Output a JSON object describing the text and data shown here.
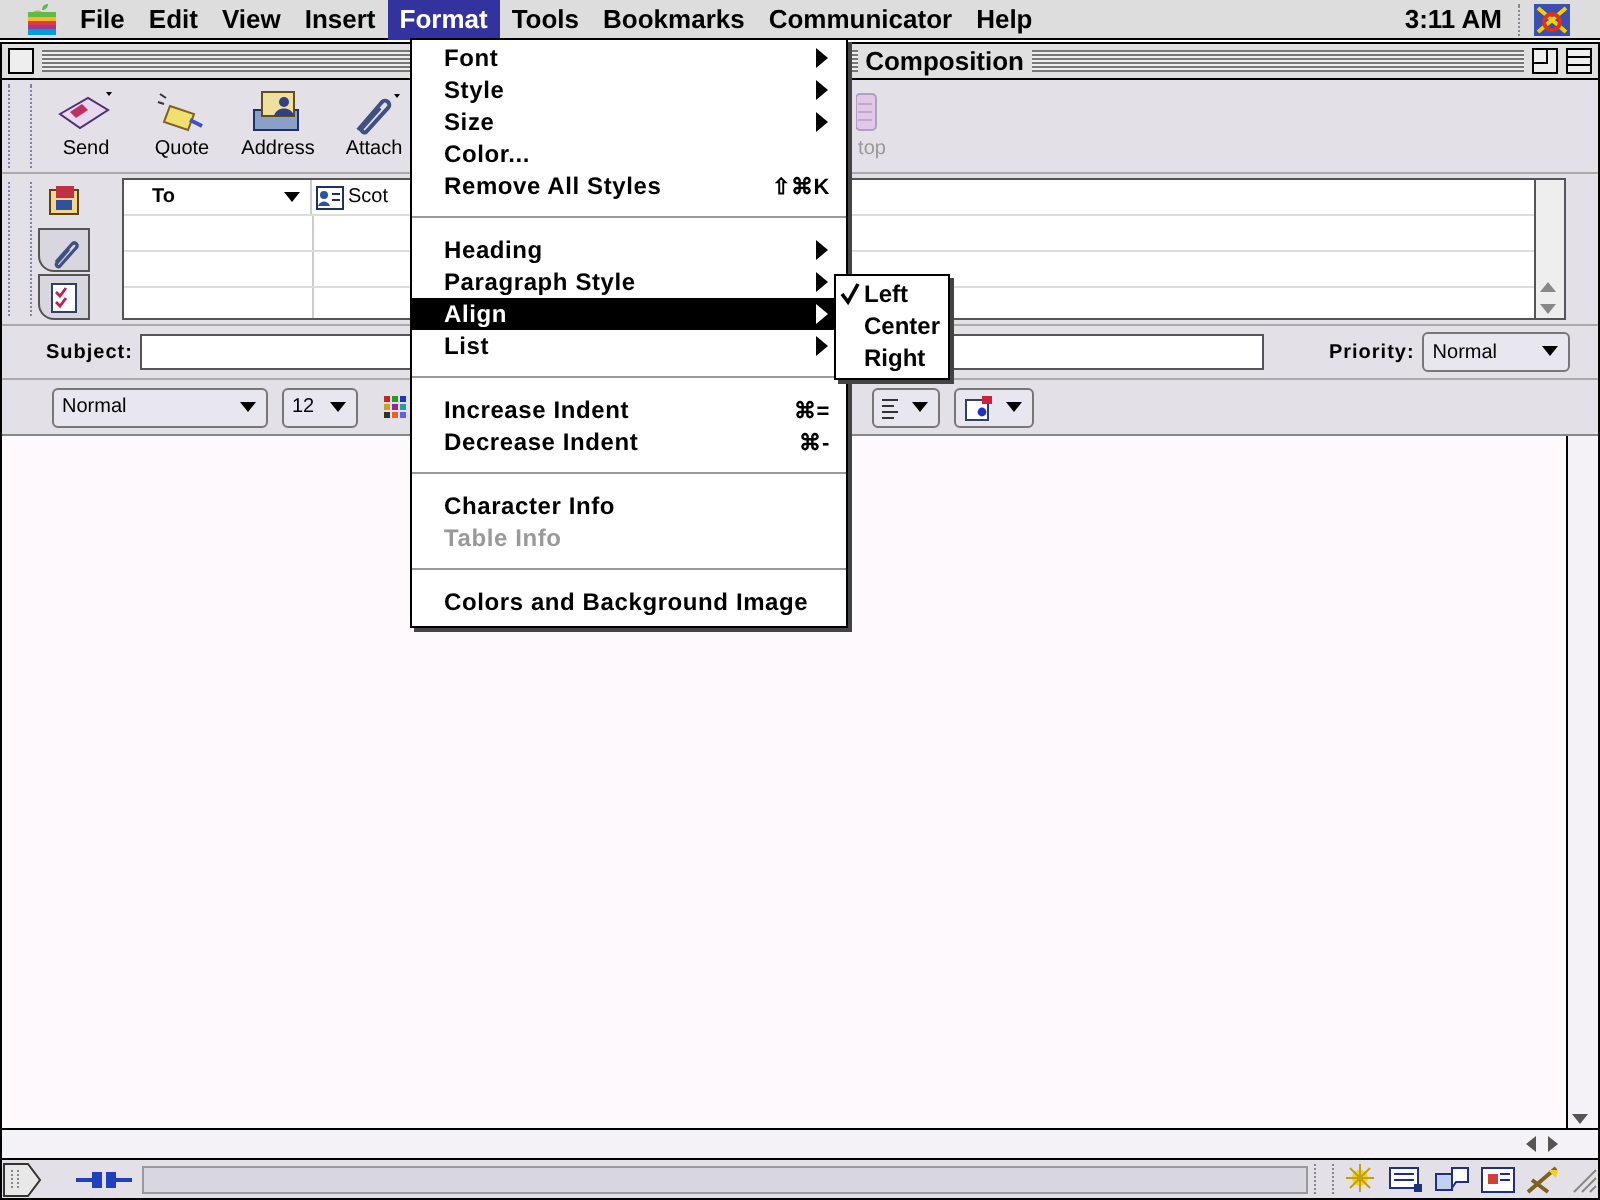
{
  "menubar": {
    "items": [
      {
        "label": "File",
        "selected": false
      },
      {
        "label": "Edit",
        "selected": false
      },
      {
        "label": "View",
        "selected": false
      },
      {
        "label": "Insert",
        "selected": false
      },
      {
        "label": "Format",
        "selected": true
      },
      {
        "label": "Tools",
        "selected": false
      },
      {
        "label": "Bookmarks",
        "selected": false
      },
      {
        "label": "Communicator",
        "selected": false
      },
      {
        "label": "Help",
        "selected": false
      }
    ],
    "clock": "3:11 AM"
  },
  "window": {
    "title": "Composition"
  },
  "toolbar": {
    "buttons": [
      {
        "label": "Send",
        "kind": "send",
        "disabled": false
      },
      {
        "label": "Quote",
        "kind": "quote",
        "disabled": false
      },
      {
        "label": "Address",
        "kind": "address",
        "disabled": false
      },
      {
        "label": "Attach",
        "kind": "attach",
        "disabled": false
      },
      {
        "label": "top",
        "kind": "stop",
        "disabled": true
      }
    ]
  },
  "addressing": {
    "tabs": [
      {
        "kind": "contacts",
        "selected": true
      },
      {
        "kind": "attachments",
        "selected": false
      },
      {
        "kind": "options",
        "selected": false
      }
    ],
    "rows": [
      {
        "type": "To",
        "recipient": "Scot"
      }
    ]
  },
  "subject": {
    "label": "Subject:"
  },
  "priority": {
    "label": "Priority:",
    "value": "Normal"
  },
  "format_toolbar": {
    "paragraph_style": "Normal",
    "font_size": "12"
  },
  "status_bar": {
    "progress": {
      "level": 0
    }
  },
  "format_menu": {
    "sections": [
      [
        {
          "label": "Font",
          "submenu": true,
          "highlighted": false,
          "disabled": false
        },
        {
          "label": "Style",
          "submenu": true,
          "highlighted": false,
          "disabled": false
        },
        {
          "label": "Size",
          "submenu": true,
          "highlighted": false,
          "disabled": false
        },
        {
          "label": "Color...",
          "submenu": false,
          "highlighted": false,
          "disabled": false
        },
        {
          "label": "Remove All Styles",
          "shortcut": "⇧⌘K",
          "submenu": false,
          "highlighted": false,
          "disabled": false
        }
      ],
      [
        {
          "label": "Heading",
          "submenu": true,
          "highlighted": false,
          "disabled": false
        },
        {
          "label": "Paragraph Style",
          "submenu": true,
          "highlighted": false,
          "disabled": false
        },
        {
          "label": "Align",
          "submenu": true,
          "highlighted": true,
          "disabled": false
        },
        {
          "label": "List",
          "submenu": true,
          "highlighted": false,
          "disabled": false
        }
      ],
      [
        {
          "label": "Increase Indent",
          "shortcut": "⌘=",
          "submenu": false,
          "highlighted": false,
          "disabled": false
        },
        {
          "label": "Decrease Indent",
          "shortcut": "⌘-",
          "submenu": false,
          "highlighted": false,
          "disabled": false
        }
      ],
      [
        {
          "label": "Character Info",
          "submenu": false,
          "highlighted": false,
          "disabled": false
        },
        {
          "label": "Table Info",
          "submenu": false,
          "highlighted": false,
          "disabled": true
        }
      ],
      [
        {
          "label": "Colors and Background Image",
          "submenu": false,
          "highlighted": false,
          "disabled": false
        }
      ]
    ]
  },
  "align_submenu": {
    "items": [
      {
        "label": "Left",
        "checked": true
      },
      {
        "label": "Center",
        "checked": false
      },
      {
        "label": "Right",
        "checked": false
      }
    ]
  }
}
